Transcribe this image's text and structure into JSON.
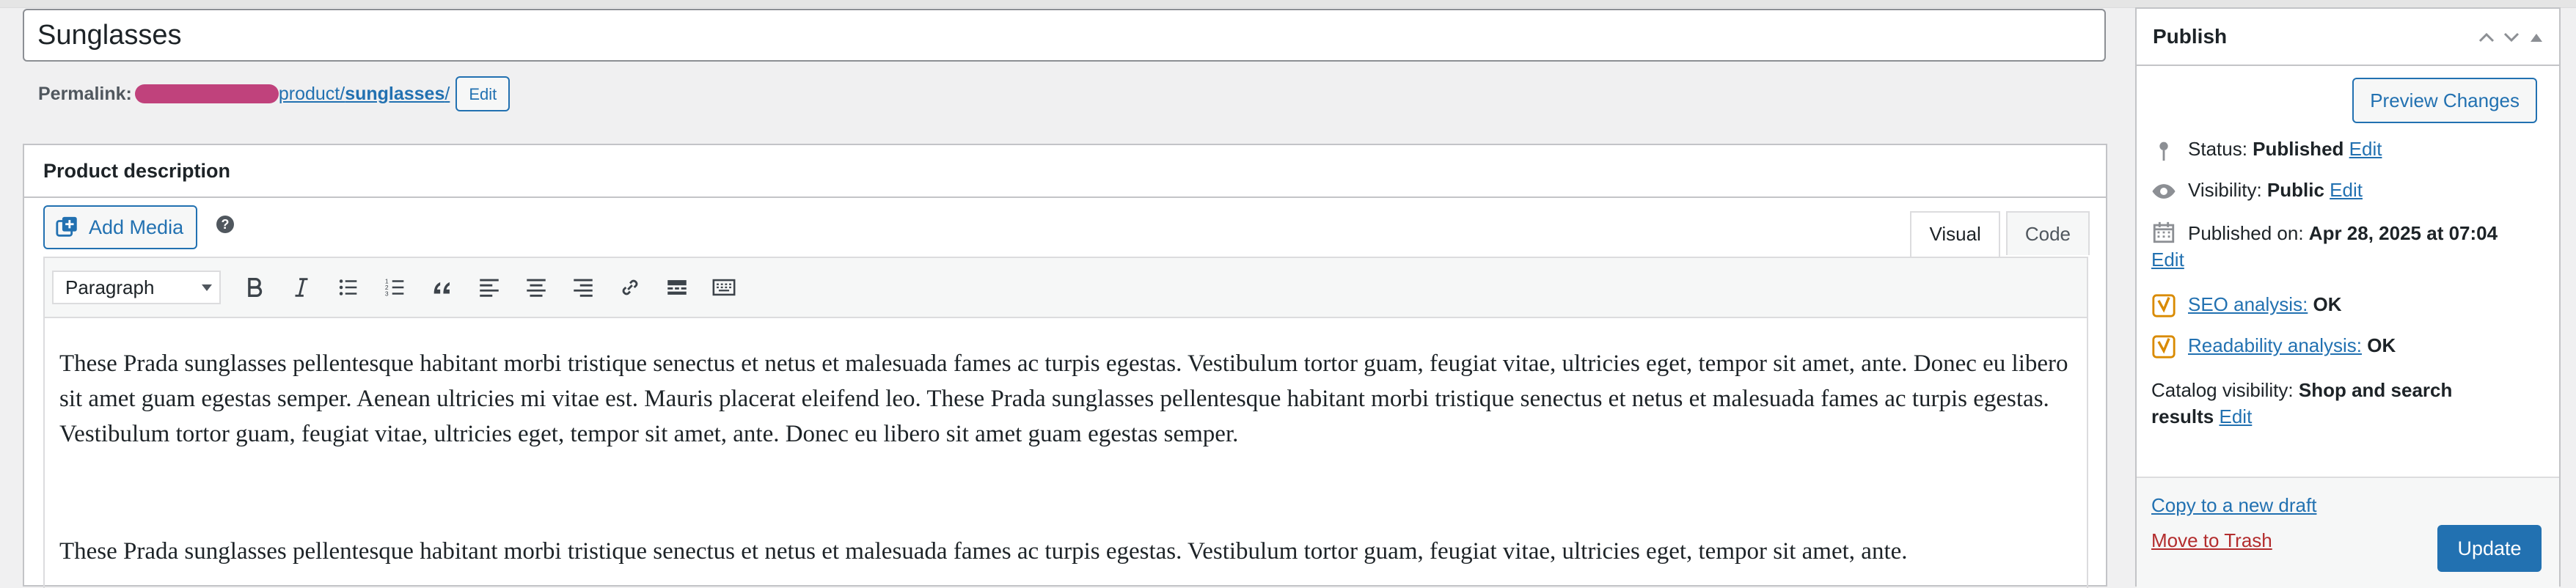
{
  "post": {
    "title": "Sunglasses",
    "permalink_label": "Permalink:",
    "permalink_path": "product/",
    "permalink_slug": "sunglasses",
    "permalink_trailing": "/",
    "permalink_edit": "Edit"
  },
  "description": {
    "heading": "Product description",
    "add_media": "Add Media",
    "help": "?",
    "tabs": [
      "Visual",
      "Code"
    ],
    "format_select": "Paragraph",
    "toolbar_icons": [
      "bold-icon",
      "italic-icon",
      "bullet-list-icon",
      "numbered-list-icon",
      "blockquote-icon",
      "align-left-icon",
      "align-center-icon",
      "align-right-icon",
      "link-icon",
      "read-more-icon",
      "toolbar-toggle-icon"
    ],
    "paragraphs": [
      "These Prada sunglasses pellentesque habitant morbi tristique senectus et netus et malesuada fames ac turpis egestas. Vestibulum tortor guam, feugiat vitae, ultricies eget, tempor sit amet, ante. Donec eu libero sit amet guam egestas semper. Aenean ultricies mi vitae est. Mauris placerat eleifend leo. These Prada sunglasses pellentesque habitant morbi tristique senectus et netus et malesuada fames ac turpis egestas. Vestibulum tortor guam, feugiat vitae, ultricies eget, tempor sit amet, ante. Donec eu libero sit amet guam egestas semper.",
      "These Prada sunglasses pellentesque habitant morbi tristique senectus et netus et malesuada fames ac turpis egestas. Vestibulum tortor guam, feugiat vitae, ultricies eget, tempor sit amet, ante."
    ]
  },
  "publish": {
    "heading": "Publish",
    "preview_button": "Preview Changes",
    "status_label": "Status:",
    "status_value": "Published",
    "visibility_label": "Visibility:",
    "visibility_value": "Public",
    "published_label": "Published on:",
    "published_value": "Apr 28, 2025 at 07:04",
    "edit_link": "Edit",
    "seo_link": "SEO analysis:",
    "seo_value": "OK",
    "readability_link": "Readability analysis:",
    "readability_value": "OK",
    "catalog_label": "Catalog visibility:",
    "catalog_value": "Shop and search results",
    "copy_draft": "Copy to a new draft",
    "trash": "Move to Trash",
    "update_button": "Update"
  },
  "colors": {
    "accent": "#2271b1",
    "trash": "#b32d2e",
    "redaction": "#c0427c",
    "yoast": "#d98a00"
  }
}
